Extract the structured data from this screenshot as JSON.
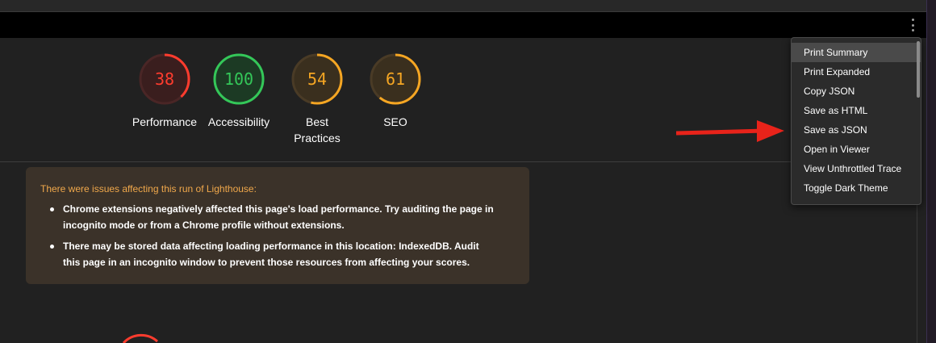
{
  "scores": [
    {
      "value": "38",
      "score": 38,
      "label": "Performance",
      "color": "#ff3c2e",
      "bg": "#3a1e1e",
      "track": "#4a2626"
    },
    {
      "value": "100",
      "score": 100,
      "label": "Accessibility",
      "color": "#34c759",
      "bg": "#1c3a24",
      "track": "#264a2e"
    },
    {
      "value": "54",
      "score": 54,
      "label": "Best Practices",
      "color": "#f5a623",
      "bg": "#3a2f1e",
      "track": "#4a3b26"
    },
    {
      "value": "61",
      "score": 61,
      "label": "SEO",
      "color": "#f5a623",
      "bg": "#3a2f1e",
      "track": "#4a3b26"
    }
  ],
  "warning": {
    "title": "There were issues affecting this run of Lighthouse:",
    "items": [
      "Chrome extensions negatively affected this page's load performance. Try auditing the page in incognito mode or from a Chrome profile without extensions.",
      "There may be stored data affecting loading performance in this location: IndexedDB. Audit this page in an incognito window to prevent those resources from affecting your scores."
    ]
  },
  "menu": {
    "items": [
      "Print Summary",
      "Print Expanded",
      "Copy JSON",
      "Save as HTML",
      "Save as JSON",
      "Open in Viewer",
      "View Unthrottled Trace",
      "Toggle Dark Theme"
    ],
    "active_index": 0
  },
  "icons": {
    "toolbar_menu": "more-vert-icon",
    "arrow": "red-arrow-icon"
  },
  "colors": {
    "arrow": "#e8231a",
    "warn_title": "#f0a84b"
  }
}
